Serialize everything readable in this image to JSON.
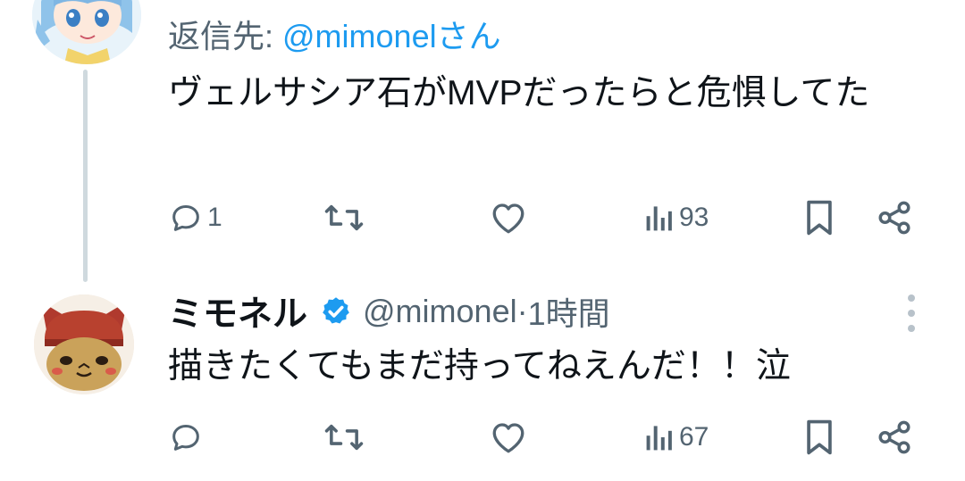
{
  "tweet1": {
    "reply_prefix": "返信先: ",
    "reply_handle": "@mimonelさん",
    "text": "ヴェルサシア石がMVPだったらと危惧してた",
    "actions": {
      "reply_count": "1",
      "views": "93"
    }
  },
  "tweet2": {
    "name": "ミモネル",
    "handle": "@mimonel",
    "separator": " · ",
    "time": "1時間",
    "text": "描きたくてもまだ持ってねえんだ！！泣",
    "actions": {
      "views": "67"
    }
  },
  "colors": {
    "accent": "#1d9bf0",
    "muted": "#536471",
    "verified": "#1d9bf0"
  }
}
